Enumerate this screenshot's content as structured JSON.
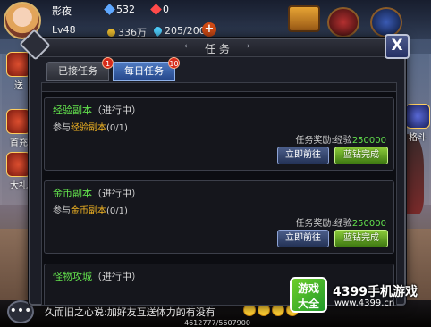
{
  "hud": {
    "player_name": "影夜",
    "level": "Lv48",
    "diamonds": "532",
    "rubies": "0",
    "gold": "336万",
    "energy": "205/200"
  },
  "side_left": {
    "item_1": "送",
    "item_2": "首充",
    "item_3": "大礼"
  },
  "side_right": {
    "item_1": "格斗"
  },
  "dialog": {
    "title": "任 务",
    "tabs": [
      {
        "label": "已接任务",
        "badge": "1"
      },
      {
        "label": "每日任务",
        "badge": "10"
      }
    ],
    "quests": [
      {
        "name": "经验副本",
        "status": "（进行中）",
        "desc_prefix": "参与",
        "desc_target": "经验副本",
        "desc_progress": "(0/1)",
        "reward_label": "任务奖励:经验",
        "reward_value": "250000",
        "go_label": "立即前往",
        "done_label": "蓝钻完成"
      },
      {
        "name": "金币副本",
        "status": "（进行中）",
        "desc_prefix": "参与",
        "desc_target": "金币副本",
        "desc_progress": "(0/1)",
        "reward_label": "任务奖励:经验",
        "reward_value": "250000",
        "go_label": "立即前往",
        "done_label": "蓝钻完成"
      },
      {
        "name": "怪物攻城",
        "status": "（进行中）"
      }
    ]
  },
  "chat": {
    "line1": "久而旧之心说 加好友互送体力的有没有",
    "line2": "久而旧之心说:加好友互送体力的有没有"
  },
  "exp_bar": "4612777/5607900",
  "watermark": {
    "logo_line1": "游戏",
    "logo_line2": "大全",
    "site_name": "4399手机游戏",
    "site_url": "www.4399.cn"
  }
}
